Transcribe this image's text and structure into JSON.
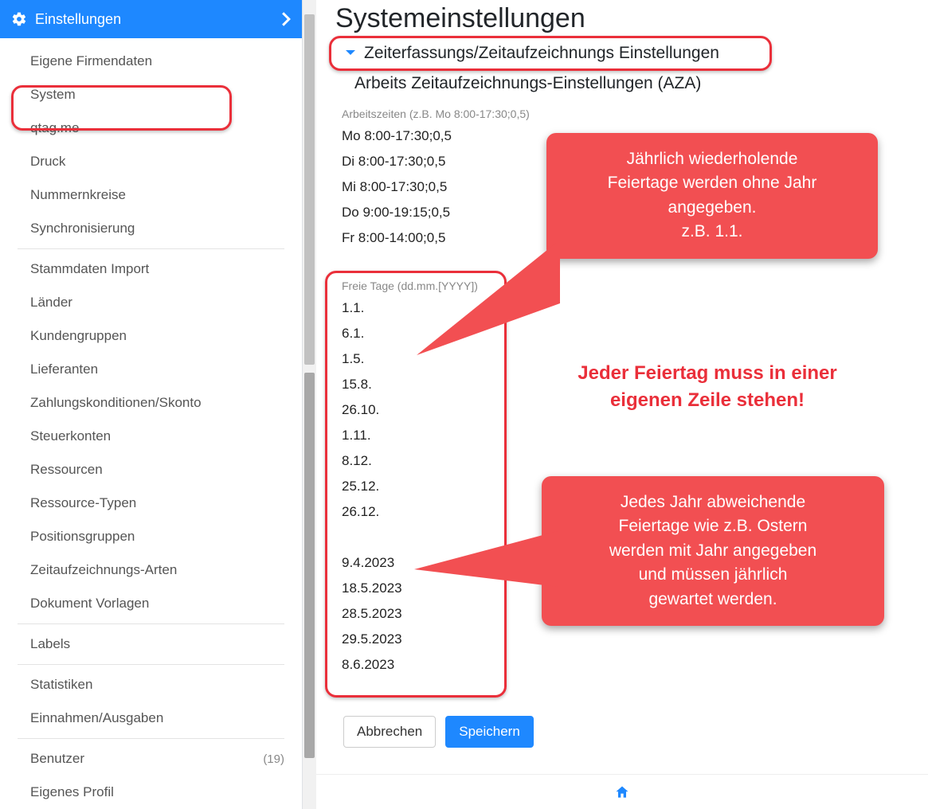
{
  "colors": {
    "accent": "#1e88ff",
    "annotation": "#ea2f3a",
    "callout_bg": "#f24f52"
  },
  "sidebar": {
    "title": "Einstellungen",
    "groups": [
      {
        "items": [
          {
            "label": "Eigene Firmendaten"
          },
          {
            "label": "System"
          },
          {
            "label": "qtag.me"
          },
          {
            "label": "Druck"
          },
          {
            "label": "Nummernkreise"
          },
          {
            "label": "Synchronisierung"
          }
        ]
      },
      {
        "items": [
          {
            "label": "Stammdaten Import"
          },
          {
            "label": "Länder"
          },
          {
            "label": "Kundengruppen"
          },
          {
            "label": "Lieferanten"
          },
          {
            "label": "Zahlungskonditionen/Skonto"
          },
          {
            "label": "Steuerkonten"
          },
          {
            "label": "Ressourcen"
          },
          {
            "label": "Ressource-Typen"
          },
          {
            "label": "Positionsgruppen"
          },
          {
            "label": "Zeitaufzeichnungs-Arten"
          },
          {
            "label": "Dokument Vorlagen"
          }
        ]
      },
      {
        "items": [
          {
            "label": "Labels"
          }
        ]
      },
      {
        "items": [
          {
            "label": "Statistiken"
          },
          {
            "label": "Einnahmen/Ausgaben"
          }
        ]
      },
      {
        "items": [
          {
            "label": "Benutzer",
            "badge": "(19)"
          },
          {
            "label": "Eigenes Profil"
          }
        ]
      }
    ]
  },
  "main": {
    "page_title": "Systemeinstellungen",
    "accordion_title": "Zeiterfassungs/Zeitaufzeichnungs Einstellungen",
    "sub_title": "Arbeits Zeitaufzeichnungs-Einstellungen (AZA)",
    "working_times": {
      "label": "Arbeitszeiten (z.B. Mo 8:00-17:30;0,5)",
      "lines": [
        "Mo 8:00-17:30;0,5",
        "Di 8:00-17:30;0,5",
        "Mi 8:00-17:30;0,5",
        "Do 9:00-19:15;0,5",
        "Fr 8:00-14:00;0,5"
      ]
    },
    "free_days": {
      "label": "Freie Tage (dd.mm.[YYYY])",
      "lines": [
        "1.1.",
        "6.1.",
        "1.5.",
        "15.8.",
        "26.10.",
        "1.11.",
        "8.12.",
        "25.12.",
        "26.12.",
        "",
        "9.4.2023",
        "18.5.2023",
        "28.5.2023",
        "29.5.2023",
        "8.6.2023"
      ]
    },
    "buttons": {
      "cancel": "Abbrechen",
      "save": "Speichern"
    }
  },
  "annotations": {
    "callout1": "Jährlich wiederholende\nFeiertage werden ohne Jahr\nangegeben.\nz.B. 1.1.",
    "note": "Jeder Feiertag muss in einer\neigenen Zeile stehen!",
    "callout2": "Jedes Jahr abweichende\nFeiertage wie z.B. Ostern\nwerden mit Jahr angegeben\nund müssen jährlich\ngewartet werden."
  }
}
